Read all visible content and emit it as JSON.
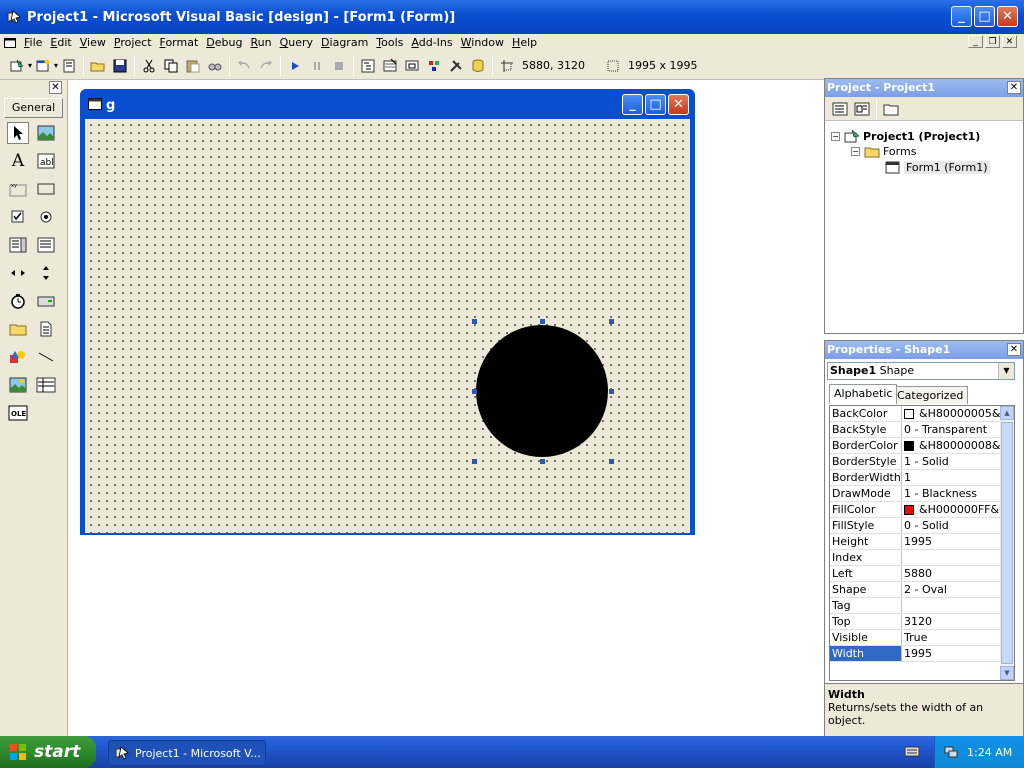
{
  "window": {
    "title": "Project1 - Microsoft Visual Basic [design] - [Form1 (Form)]",
    "min": "_",
    "max": "□",
    "close": "✕"
  },
  "menu": [
    "File",
    "Edit",
    "View",
    "Project",
    "Format",
    "Debug",
    "Run",
    "Query",
    "Diagram",
    "Tools",
    "Add-Ins",
    "Window",
    "Help"
  ],
  "toolbar": {
    "position": "5880, 3120",
    "size": "1995 x 1995"
  },
  "toolbox": {
    "title": "General",
    "close": "✕"
  },
  "form": {
    "title": "g"
  },
  "project": {
    "title": "Project - Project1",
    "tree": {
      "root": "Project1 (Project1)",
      "folder": "Forms",
      "item": "Form1 (Form1)"
    }
  },
  "properties": {
    "title": "Properties - Shape1",
    "object_name": "Shape1",
    "object_type": "Shape",
    "tab_alphabetic": "Alphabetic",
    "tab_categorized": "Categorized",
    "rows": [
      {
        "name": "BackColor",
        "value": "&H80000005&",
        "swatch": "#ffffff"
      },
      {
        "name": "BackStyle",
        "value": "0 - Transparent"
      },
      {
        "name": "BorderColor",
        "value": "&H80000008&",
        "swatch": "#000000"
      },
      {
        "name": "BorderStyle",
        "value": "1 - Solid"
      },
      {
        "name": "BorderWidth",
        "value": "1"
      },
      {
        "name": "DrawMode",
        "value": "1 - Blackness"
      },
      {
        "name": "FillColor",
        "value": "&H000000FF&",
        "swatch": "#e01010"
      },
      {
        "name": "FillStyle",
        "value": "0 - Solid"
      },
      {
        "name": "Height",
        "value": "1995"
      },
      {
        "name": "Index",
        "value": ""
      },
      {
        "name": "Left",
        "value": "5880"
      },
      {
        "name": "Shape",
        "value": "2 - Oval"
      },
      {
        "name": "Tag",
        "value": ""
      },
      {
        "name": "Top",
        "value": "3120"
      },
      {
        "name": "Visible",
        "value": "True"
      },
      {
        "name": "Width",
        "value": "1995"
      }
    ],
    "selected_index": 15,
    "description_title": "Width",
    "description_text": "Returns/sets the width of an object."
  },
  "taskbar": {
    "start": "start",
    "task": "Project1 - Microsoft V...",
    "time": "1:24 AM"
  }
}
